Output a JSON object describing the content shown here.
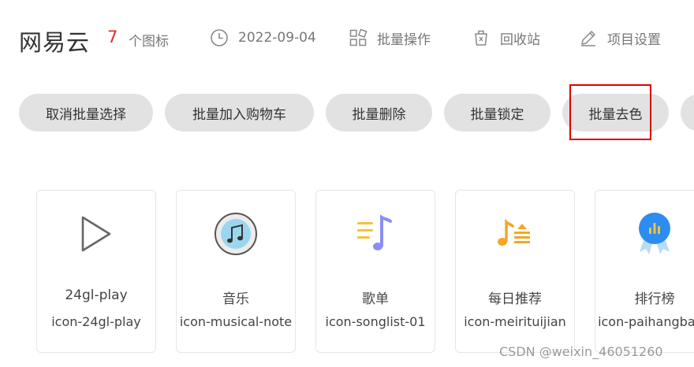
{
  "header": {
    "title": "网易云",
    "icon_count": "7",
    "icon_count_label": "个图标",
    "date": "2022-09-04",
    "batch_label": "批量操作",
    "recycle_label": "回收站",
    "settings_label": "项目设置"
  },
  "toolbar": {
    "buttons": [
      {
        "label": "取消批量选择"
      },
      {
        "label": "批量加入购物车"
      },
      {
        "label": "批量删除"
      },
      {
        "label": "批量锁定"
      },
      {
        "label": "批量去色"
      },
      {
        "label": ""
      }
    ],
    "highlight_color": "#e00000"
  },
  "icons": [
    {
      "name": "24gl-play",
      "code": "icon-24gl-play",
      "icon": "play-icon"
    },
    {
      "name": "音乐",
      "code": "icon-musical-note",
      "icon": "musical-note-icon"
    },
    {
      "name": "歌单",
      "code": "icon-songlist-01",
      "icon": "songlist-icon"
    },
    {
      "name": "每日推荐",
      "code": "icon-meirituijian",
      "icon": "daily-recommend-icon"
    },
    {
      "name": "排行榜",
      "code": "icon-paihangbang",
      "icon": "ranking-icon"
    }
  ],
  "watermark": "CSDN @weixin_46051260",
  "colors": {
    "accent_red": "#e02b2b",
    "button_bg": "#e2e2e2",
    "card_border": "#e6e6e6"
  }
}
